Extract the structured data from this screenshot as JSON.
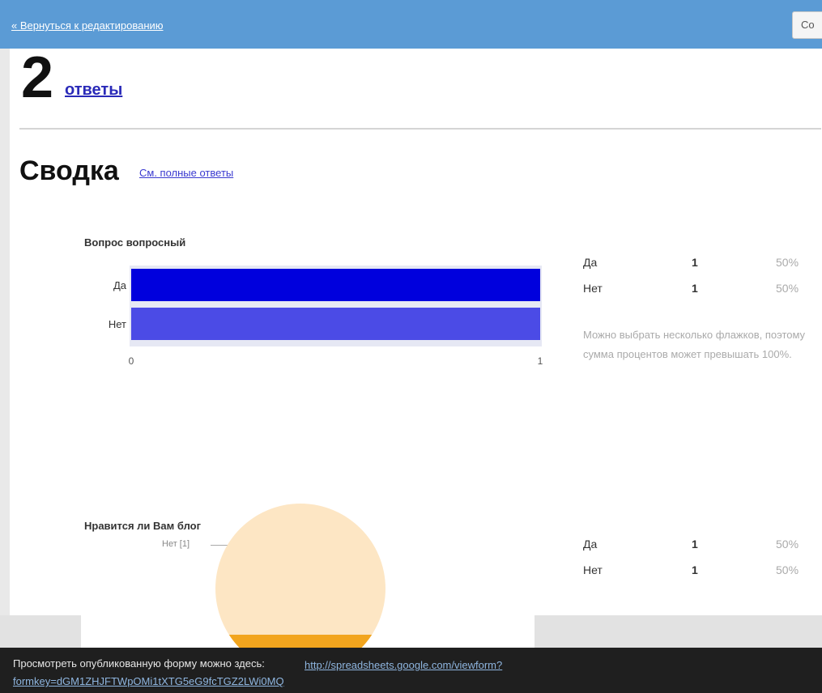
{
  "header": {
    "back_link": "« Вернуться к редактированию",
    "button_label": "Со"
  },
  "responses": {
    "count": "2",
    "label": "ответы"
  },
  "summary": {
    "title": "Сводка",
    "link": "См. полные ответы"
  },
  "questions": [
    {
      "title": "Вопрос вопросный",
      "stats": [
        {
          "label": "Да",
          "count": "1",
          "percent": "50%"
        },
        {
          "label": "Нет",
          "count": "1",
          "percent": "50%"
        }
      ],
      "note": "Можно выбрать несколько флажков, поэтому сумма процентов может превышать 100%."
    },
    {
      "title": "Нравится ли Вам блог",
      "stats": [
        {
          "label": "Да",
          "count": "1",
          "percent": "50%"
        },
        {
          "label": "Нет",
          "count": "1",
          "percent": "50%"
        }
      ],
      "pie_label": "Нет [1]"
    }
  ],
  "colors": {
    "header": "#5b9bd5",
    "bar_yes": "#0000dd",
    "bar_no": "#4b4be6",
    "pie_light": "#fde6c4",
    "pie_dark": "#f2a51e",
    "footer": "#1f1f1f"
  },
  "chart_data": {
    "type": "bar",
    "orientation": "horizontal",
    "title": "Вопрос вопросный",
    "categories": [
      "Да",
      "Нет"
    ],
    "values": [
      1,
      1
    ],
    "xlim": [
      0,
      1
    ],
    "xticks": [
      "0",
      "1"
    ],
    "grid": false
  },
  "footer": {
    "text": "Просмотреть опубликованную форму можно здесь:",
    "link": "http://spreadsheets.google.com/viewform?formkey=dGM1ZHJFTWpOMi1tXTG5eG9fcTGZ2LWi0MQ"
  }
}
